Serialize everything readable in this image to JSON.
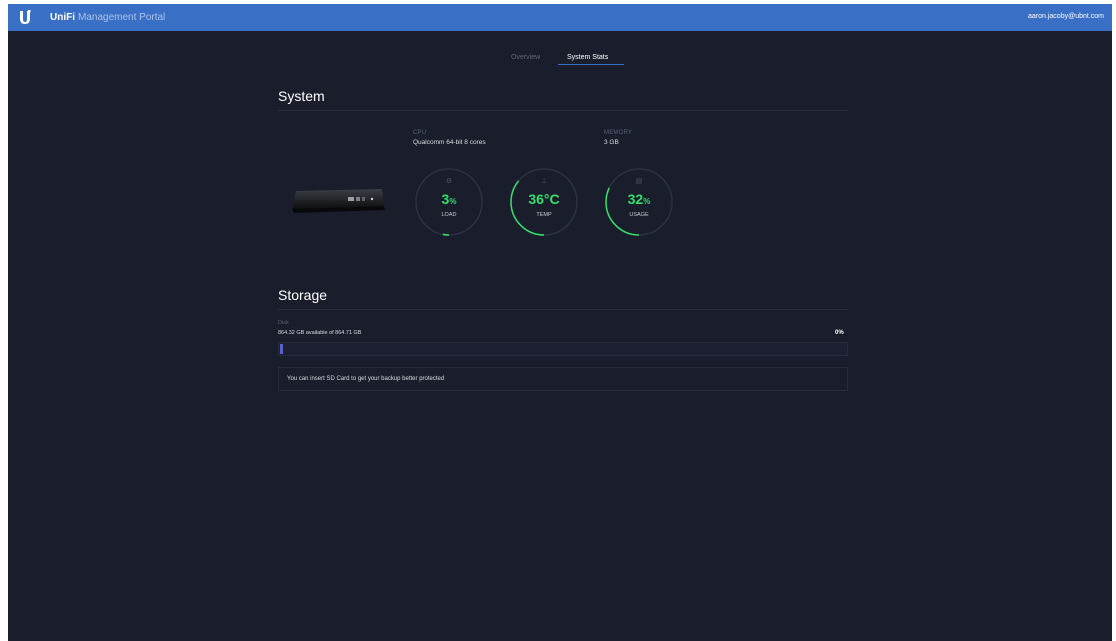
{
  "header": {
    "brand_name": "UniFi",
    "brand_sub": "Management Portal",
    "user_email": "aaron.jacoby@ubnt.com"
  },
  "tabs": [
    {
      "label": "Overview",
      "active": false
    },
    {
      "label": "System Stats",
      "active": true
    }
  ],
  "system": {
    "title": "System",
    "cpu": {
      "label": "CPU",
      "value": "Qualcomm 64-bit 8 cores"
    },
    "memory": {
      "label": "MEMORY",
      "value": "3 GB"
    },
    "gauges": [
      {
        "name": "load",
        "value": "3",
        "unit": "%",
        "label": "LOAD",
        "fraction": 0.03,
        "icon": "cpu-icon"
      },
      {
        "name": "temp",
        "value": "36°C",
        "unit": "",
        "label": "TEMP",
        "fraction": 0.36,
        "icon": "thermometer-icon"
      },
      {
        "name": "usage",
        "value": "32",
        "unit": "%",
        "label": "USAGE",
        "fraction": 0.32,
        "icon": "memory-icon"
      }
    ]
  },
  "storage": {
    "title": "Storage",
    "disk_label": "Disk",
    "disk_available": "864.32 GB available of 864.71 GB",
    "disk_percent": "0%",
    "disk_fraction": 0.0,
    "notice": "You can insert SD Card to get your backup better protected"
  },
  "colors": {
    "accent": "#3a6fc6",
    "gauge": "#33e06b",
    "background": "#1a1e2c"
  }
}
